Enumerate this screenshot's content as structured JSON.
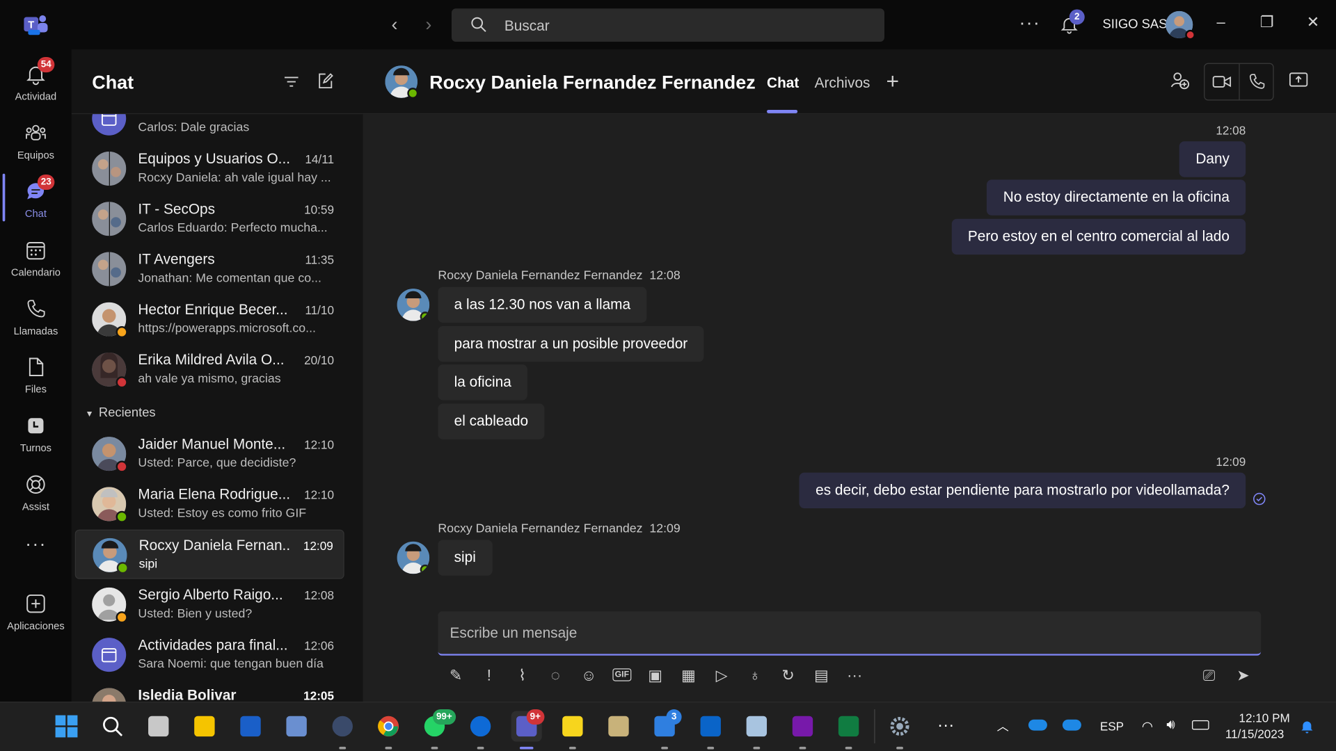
{
  "titlebar": {
    "search_placeholder": "Buscar",
    "notification_count": "2",
    "org_name": "SIIGO SAS"
  },
  "rail": [
    {
      "label": "Actividad",
      "badge": "54"
    },
    {
      "label": "Equipos",
      "badge": ""
    },
    {
      "label": "Chat",
      "badge": "23"
    },
    {
      "label": "Calendario",
      "badge": ""
    },
    {
      "label": "Llamadas",
      "badge": ""
    },
    {
      "label": "Files",
      "badge": ""
    },
    {
      "label": "Turnos",
      "badge": ""
    },
    {
      "label": "Assist",
      "badge": ""
    },
    {
      "label": "",
      "badge": ""
    },
    {
      "label": "Aplicaciones",
      "badge": ""
    }
  ],
  "chatlist": {
    "title": "Chat",
    "recent_label": "Recientes",
    "pinned": [
      {
        "name": "",
        "time": "",
        "preview": "Carlos: Dale gracias"
      },
      {
        "name": "Equipos y Usuarios O...",
        "time": "14/11",
        "preview": "Rocxy Daniela: ah vale igual hay ..."
      },
      {
        "name": "IT - SecOps",
        "time": "10:59",
        "preview": "Carlos Eduardo: Perfecto mucha..."
      },
      {
        "name": "IT Avengers",
        "time": "11:35",
        "preview": "Jonathan: Me comentan que co..."
      },
      {
        "name": "Hector Enrique Becer...",
        "time": "11/10",
        "preview": "https://powerapps.microsoft.co..."
      },
      {
        "name": "Erika Mildred Avila O...",
        "time": "20/10",
        "preview": "ah vale ya mismo, gracias"
      }
    ],
    "recent": [
      {
        "name": "Jaider Manuel Monte...",
        "time": "12:10",
        "preview": "Usted: Parce, que decidiste?"
      },
      {
        "name": "Maria Elena Rodrigue...",
        "time": "12:10",
        "preview": "Usted: Estoy es como frito  GIF"
      },
      {
        "name": "Rocxy Daniela Fernan...",
        "time": "12:09",
        "preview": "sipi"
      },
      {
        "name": "Sergio Alberto Raigo...",
        "time": "12:08",
        "preview": "Usted: Bien y usted?"
      },
      {
        "name": "Actividades para final...",
        "time": "12:06",
        "preview": "Sara Noemi: que tengan buen día"
      },
      {
        "name": "Isledia Bolivar",
        "time": "12:05",
        "preview": ""
      }
    ]
  },
  "conversation": {
    "contact_name": "Rocxy Daniela Fernandez Fernandez",
    "tabs": [
      "Chat",
      "Archivos"
    ],
    "sent_1": {
      "time": "12:08",
      "messages": [
        "Dany",
        "No estoy directamente en la oficina",
        "Pero estoy en el centro comercial al lado"
      ]
    },
    "received_1": {
      "sender": "Rocxy Daniela Fernandez Fernandez",
      "time": "12:08",
      "messages": [
        "a las 12.30 nos van a llama",
        "para mostrar a un posible proveedor",
        "la oficina",
        "el cableado"
      ]
    },
    "sent_2": {
      "time": "12:09",
      "messages": [
        "es decir, debo estar pendiente para  mostrarlo por videollamada?"
      ]
    },
    "received_2": {
      "sender": "Rocxy Daniela Fernandez Fernandez",
      "time": "12:09",
      "messages": [
        "sipi"
      ]
    },
    "compose_placeholder": "Escribe un mensaje"
  },
  "taskbar": {
    "whatsapp_badge": "99+",
    "teams_badge": "9+",
    "todo_badge": "3",
    "language": "ESP",
    "time": "12:10 PM",
    "date": "11/15/2023"
  },
  "colors": {
    "accent": "#7f85f5",
    "badge_red": "#d13438",
    "presence_available": "#6bb700",
    "presence_away": "#f8a41b"
  }
}
